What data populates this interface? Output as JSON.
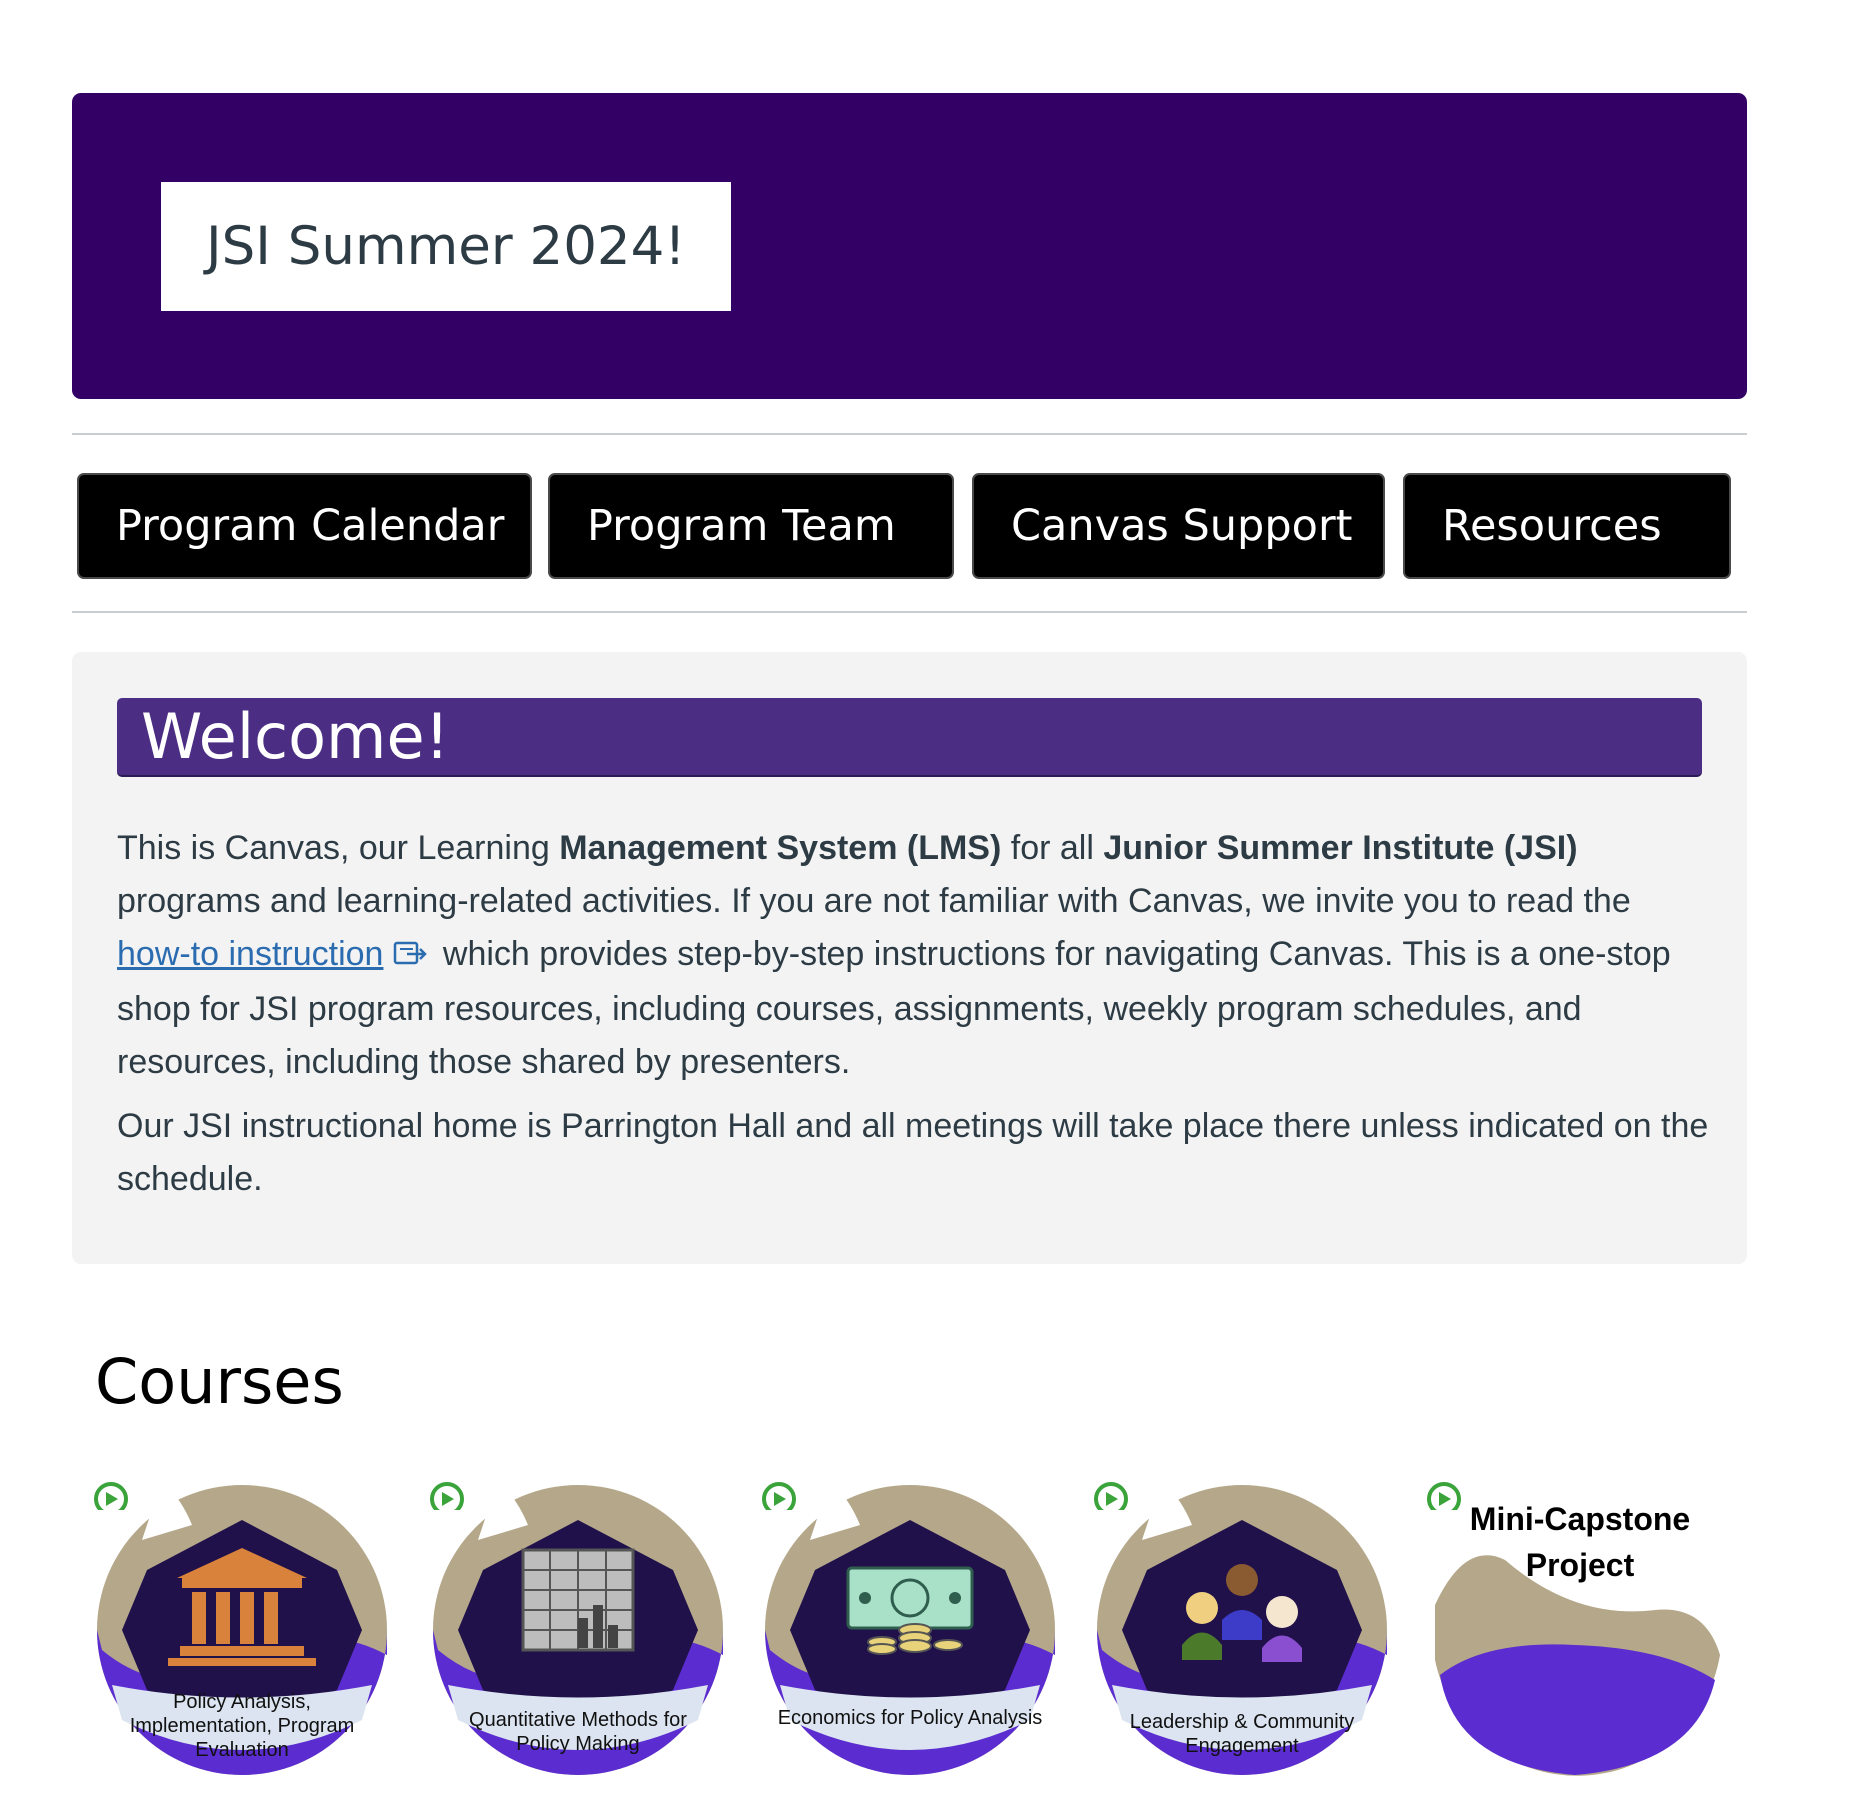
{
  "banner": {
    "title": "JSI Summer 2024!",
    "background": "#330066"
  },
  "nav": [
    {
      "label": "Program Calendar"
    },
    {
      "label": "Program Team"
    },
    {
      "label": "Canvas Support"
    },
    {
      "label": "Resources"
    }
  ],
  "welcome": {
    "heading": "Welcome!",
    "p1_a": "This is Canvas, our Learning ",
    "p1_b": "Management System (LMS)",
    "p1_c": " for all ",
    "p1_d": "Junior Summer Institute (JSI)",
    "p1_e": " programs and learning-related activities. If you are not familiar with Canvas, we invite you to read the ",
    "link_text": "how-to instruction",
    "p1_f": " which provides step-by-step instructions for navigating Canvas. This is a one-stop shop for JSI program resources, including courses, assignments, weekly program schedules, and resources, including those shared by presenters.",
    "p2": "Our JSI instructional home is Parrington Hall and all meetings will take place there unless indicated on the schedule."
  },
  "courses": {
    "title": "Courses",
    "items": [
      {
        "label": "Policy Analysis, Implementation, Program Evaluation",
        "icon": "government-building-icon"
      },
      {
        "label": "Quantitative Methods for Policy Making",
        "icon": "spreadsheet-chart-icon"
      },
      {
        "label": "Economics for Policy Analysis",
        "icon": "money-coins-icon"
      },
      {
        "label": "Leadership & Community Engagement",
        "icon": "people-group-icon"
      },
      {
        "label": "Mini-Capstone Project",
        "icon": ""
      }
    ]
  },
  "colors": {
    "banner": "#330066",
    "welcome_header": "#4b2e83",
    "course_purple": "#5b2ccf",
    "course_hex": "#20114a",
    "link": "#2b6cb0"
  }
}
